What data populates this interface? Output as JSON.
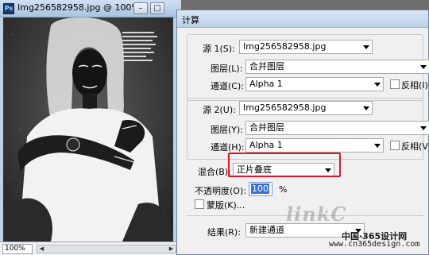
{
  "document": {
    "title": "Img256582958.jpg @ 100%...",
    "ps_badge": "Ps",
    "zoom": "100%",
    "magazine_text": "We think is the fall trends and the hottest looks that you can invest in for the upcoming season"
  },
  "dialog": {
    "title": "计算",
    "source1": {
      "label": "源 1(S):",
      "file": "Img256582958.jpg",
      "layer_label": "图层(L):",
      "layer": "合并图层",
      "channel_label": "通道(C):",
      "channel": "Alpha 1",
      "invert_label": "反相(I)"
    },
    "source2": {
      "label": "源 2(U):",
      "file": "Img256582958.jpg",
      "layer_label": "图层(Y):",
      "layer": "合并图层",
      "channel_label": "通道(H):",
      "channel": "Alpha 1",
      "invert_label": "反相(V)"
    },
    "blend": {
      "label": "混合(B):",
      "mode": "正片叠底",
      "opacity_label": "不透明度(O):",
      "opacity": "100",
      "percent": "%",
      "mask_label": "蒙版(K)..."
    },
    "result": {
      "label": "结果(R):",
      "value": "新建通道"
    }
  },
  "watermark": {
    "script": "linkC",
    "site": "中国·365设计网",
    "url": "www.cn365design.com"
  },
  "colors": {
    "highlight_box": "#e0142b",
    "selection": "#3a6fd8"
  }
}
